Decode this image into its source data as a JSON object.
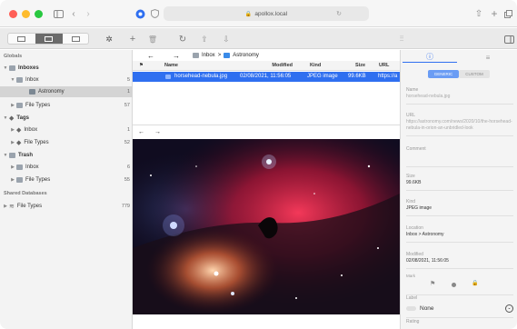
{
  "window": {
    "url": "apollox.local",
    "colors": {
      "close": "#ff5f57",
      "minimize": "#febc2e",
      "maximize": "#28c840",
      "accent": "#2f6ff0"
    }
  },
  "sidebar": {
    "globals_label": "Globals",
    "items": [
      {
        "label": "Inboxes",
        "count": "",
        "level": 0
      },
      {
        "label": "Inbox",
        "count": "5",
        "level": 1
      },
      {
        "label": "Astronomy",
        "count": "1",
        "level": 2
      },
      {
        "label": "File Types",
        "count": "57",
        "level": 1
      },
      {
        "label": "Tags",
        "count": "",
        "level": 0
      },
      {
        "label": "Inbox",
        "count": "1",
        "level": 1
      },
      {
        "label": "File Types",
        "count": "52",
        "level": 1
      },
      {
        "label": "Trash",
        "count": "",
        "level": 0
      },
      {
        "label": "Inbox",
        "count": "6",
        "level": 1
      },
      {
        "label": "File Types",
        "count": "55",
        "level": 1
      }
    ],
    "shared_label": "Shared Databases",
    "shared_items": [
      {
        "label": "File Types",
        "count": "779"
      }
    ]
  },
  "breadcrumb": {
    "root": "Inbox",
    "separator": ">",
    "current": "Astronomy"
  },
  "table": {
    "headers": {
      "name": "Name",
      "modified": "Modified",
      "kind": "Kind",
      "size": "Size",
      "url": "URL"
    },
    "rows": [
      {
        "name": "horsehead-nebula.jpg",
        "modified": "02/08/2021, 11:56:05",
        "kind": "JPEG image",
        "size": "99.6KB",
        "url": "https://a"
      }
    ]
  },
  "inspector": {
    "seg_generic": "GENERIC",
    "seg_custom": "CUSTOM",
    "name_label": "Name",
    "name_value": "horsehead-nebula.jpg",
    "url_label": "URL",
    "url_value": "https://astronomy.com/news/2020/10/the-horsehead-nebula-in-orion-an-unbridled-look",
    "comment_label": "Comment",
    "size_label": "Size",
    "size_value": "99.6KB",
    "kind_label": "Kind",
    "kind_value": "JPEG image",
    "location_label": "Location",
    "location_value": "Inbox > Astronomy",
    "modified_label": "Modified",
    "modified_value": "02/08/2021, 11:56:05",
    "mark_label": "Mark",
    "label_label": "Label",
    "label_value": "None",
    "rating_label": "Rating"
  }
}
